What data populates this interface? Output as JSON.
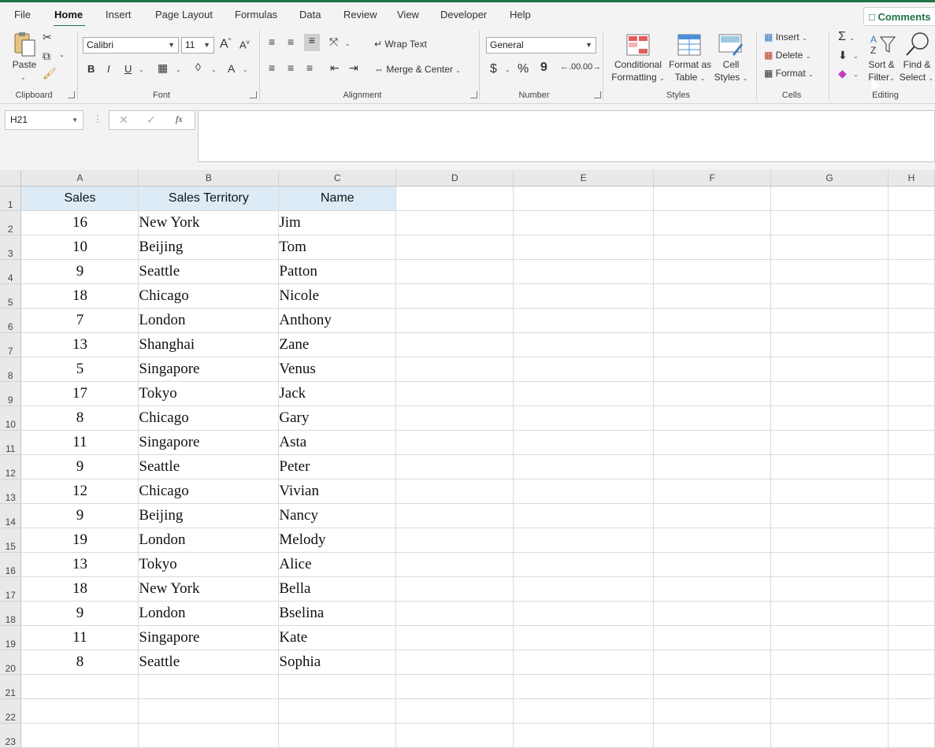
{
  "menu": {
    "tabs": [
      {
        "label": "File"
      },
      {
        "label": "Home"
      },
      {
        "label": "Insert"
      },
      {
        "label": "Page Layout"
      },
      {
        "label": "Formulas"
      },
      {
        "label": "Data"
      },
      {
        "label": "Review"
      },
      {
        "label": "View"
      },
      {
        "label": "Developer"
      },
      {
        "label": "Help"
      }
    ],
    "comments_label": "Comments"
  },
  "ribbon": {
    "clipboard": {
      "paste": "Paste",
      "group": "Clipboard"
    },
    "font": {
      "name": "Calibri",
      "size": "11",
      "grow": "A",
      "shrink": "A",
      "bold": "B",
      "italic": "I",
      "underline": "U",
      "fontcolor": "A",
      "group": "Font"
    },
    "alignment": {
      "wrap": "Wrap Text",
      "merge": "Merge & Center",
      "group": "Alignment"
    },
    "number": {
      "format": "General",
      "currency": "$",
      "percent": "%",
      "comma": "9",
      "group": "Number"
    },
    "styles": {
      "conditional_l1": "Conditional",
      "conditional_l2": "Formatting",
      "format_table_l1": "Format as",
      "format_table_l2": "Table",
      "cell_styles_l1": "Cell",
      "cell_styles_l2": "Styles",
      "group": "Styles"
    },
    "cells": {
      "insert": "Insert",
      "delete": "Delete",
      "format": "Format",
      "group": "Cells"
    },
    "editing": {
      "sort_l1": "Sort &",
      "sort_l2": "Filter",
      "find_l1": "Find &",
      "find_l2": "Select",
      "sum": "Σ",
      "group": "Editing"
    }
  },
  "formula_bar": {
    "name_box": "H21",
    "fx": "fx",
    "content": ""
  },
  "sheet": {
    "columns": [
      "A",
      "B",
      "C",
      "D",
      "E",
      "F",
      "G",
      "H"
    ],
    "header_row": [
      "Sales",
      "Sales Territory",
      "Name"
    ],
    "rows": [
      [
        "16",
        "New York",
        "Jim"
      ],
      [
        "10",
        "Beijing",
        "Tom"
      ],
      [
        "9",
        "Seattle",
        "Patton"
      ],
      [
        "18",
        "Chicago",
        "Nicole"
      ],
      [
        "7",
        "London",
        "Anthony"
      ],
      [
        "13",
        "Shanghai",
        "Zane"
      ],
      [
        "5",
        "Singapore",
        "Venus"
      ],
      [
        "17",
        "Tokyo",
        "Jack"
      ],
      [
        "8",
        "Chicago",
        "Gary"
      ],
      [
        "11",
        "Singapore",
        "Asta"
      ],
      [
        "9",
        "Seattle",
        "Peter"
      ],
      [
        "12",
        "Chicago",
        "Vivian"
      ],
      [
        "9",
        "Beijing",
        "Nancy"
      ],
      [
        "19",
        "London",
        "Melody"
      ],
      [
        "13",
        "Tokyo",
        "Alice"
      ],
      [
        "18",
        "New York",
        "Bella"
      ],
      [
        "9",
        "London",
        "Bselina"
      ],
      [
        "11",
        "Singapore",
        "Kate"
      ],
      [
        "8",
        "Seattle",
        "Sophia"
      ]
    ],
    "row_numbers": [
      "1",
      "2",
      "3",
      "4",
      "5",
      "6",
      "7",
      "8",
      "9",
      "10",
      "11",
      "12",
      "13",
      "14",
      "15",
      "16",
      "17",
      "18",
      "19",
      "20",
      "21",
      "22",
      "23"
    ]
  }
}
